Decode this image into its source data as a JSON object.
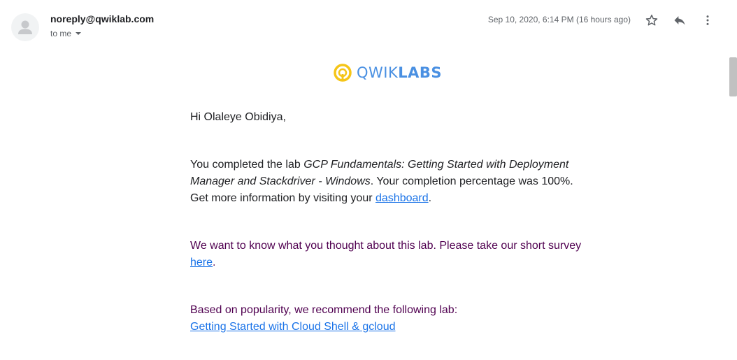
{
  "header": {
    "sender": "noreply@qwiklab.com",
    "recipient": "to me",
    "timestamp": "Sep 10, 2020, 6:14 PM (16 hours ago)",
    "icons": {
      "star": "star-icon",
      "reply": "reply-icon",
      "more": "more-vert-icon",
      "avatar": "person-icon"
    }
  },
  "logo": {
    "text_light": "QWIK",
    "text_bold": "LABS",
    "colors": {
      "ring": "#f5c518",
      "text": "#4a90e2"
    }
  },
  "body": {
    "greeting": "Hi Olaleye Obidiya,",
    "completed_prefix": "You completed the lab ",
    "lab_name": "GCP Fundamentals: Getting Started with Deployment Manager and Stackdriver - Windows",
    "completed_suffix": ". Your completion percentage was 100%. Get more information by visiting your ",
    "dashboard_link": "dashboard",
    "period1": ".",
    "survey_prefix": "We want to know what you thought about this lab. Please take our short survey ",
    "survey_link": "here",
    "period2": ".",
    "recommend_text": "Based on popularity, we recommend the following lab:",
    "recommend_link": "Getting Started with Cloud Shell & gcloud"
  },
  "colors": {
    "link": "#1a73e8",
    "quoted_text": "#500050",
    "muted": "#5f6368"
  }
}
